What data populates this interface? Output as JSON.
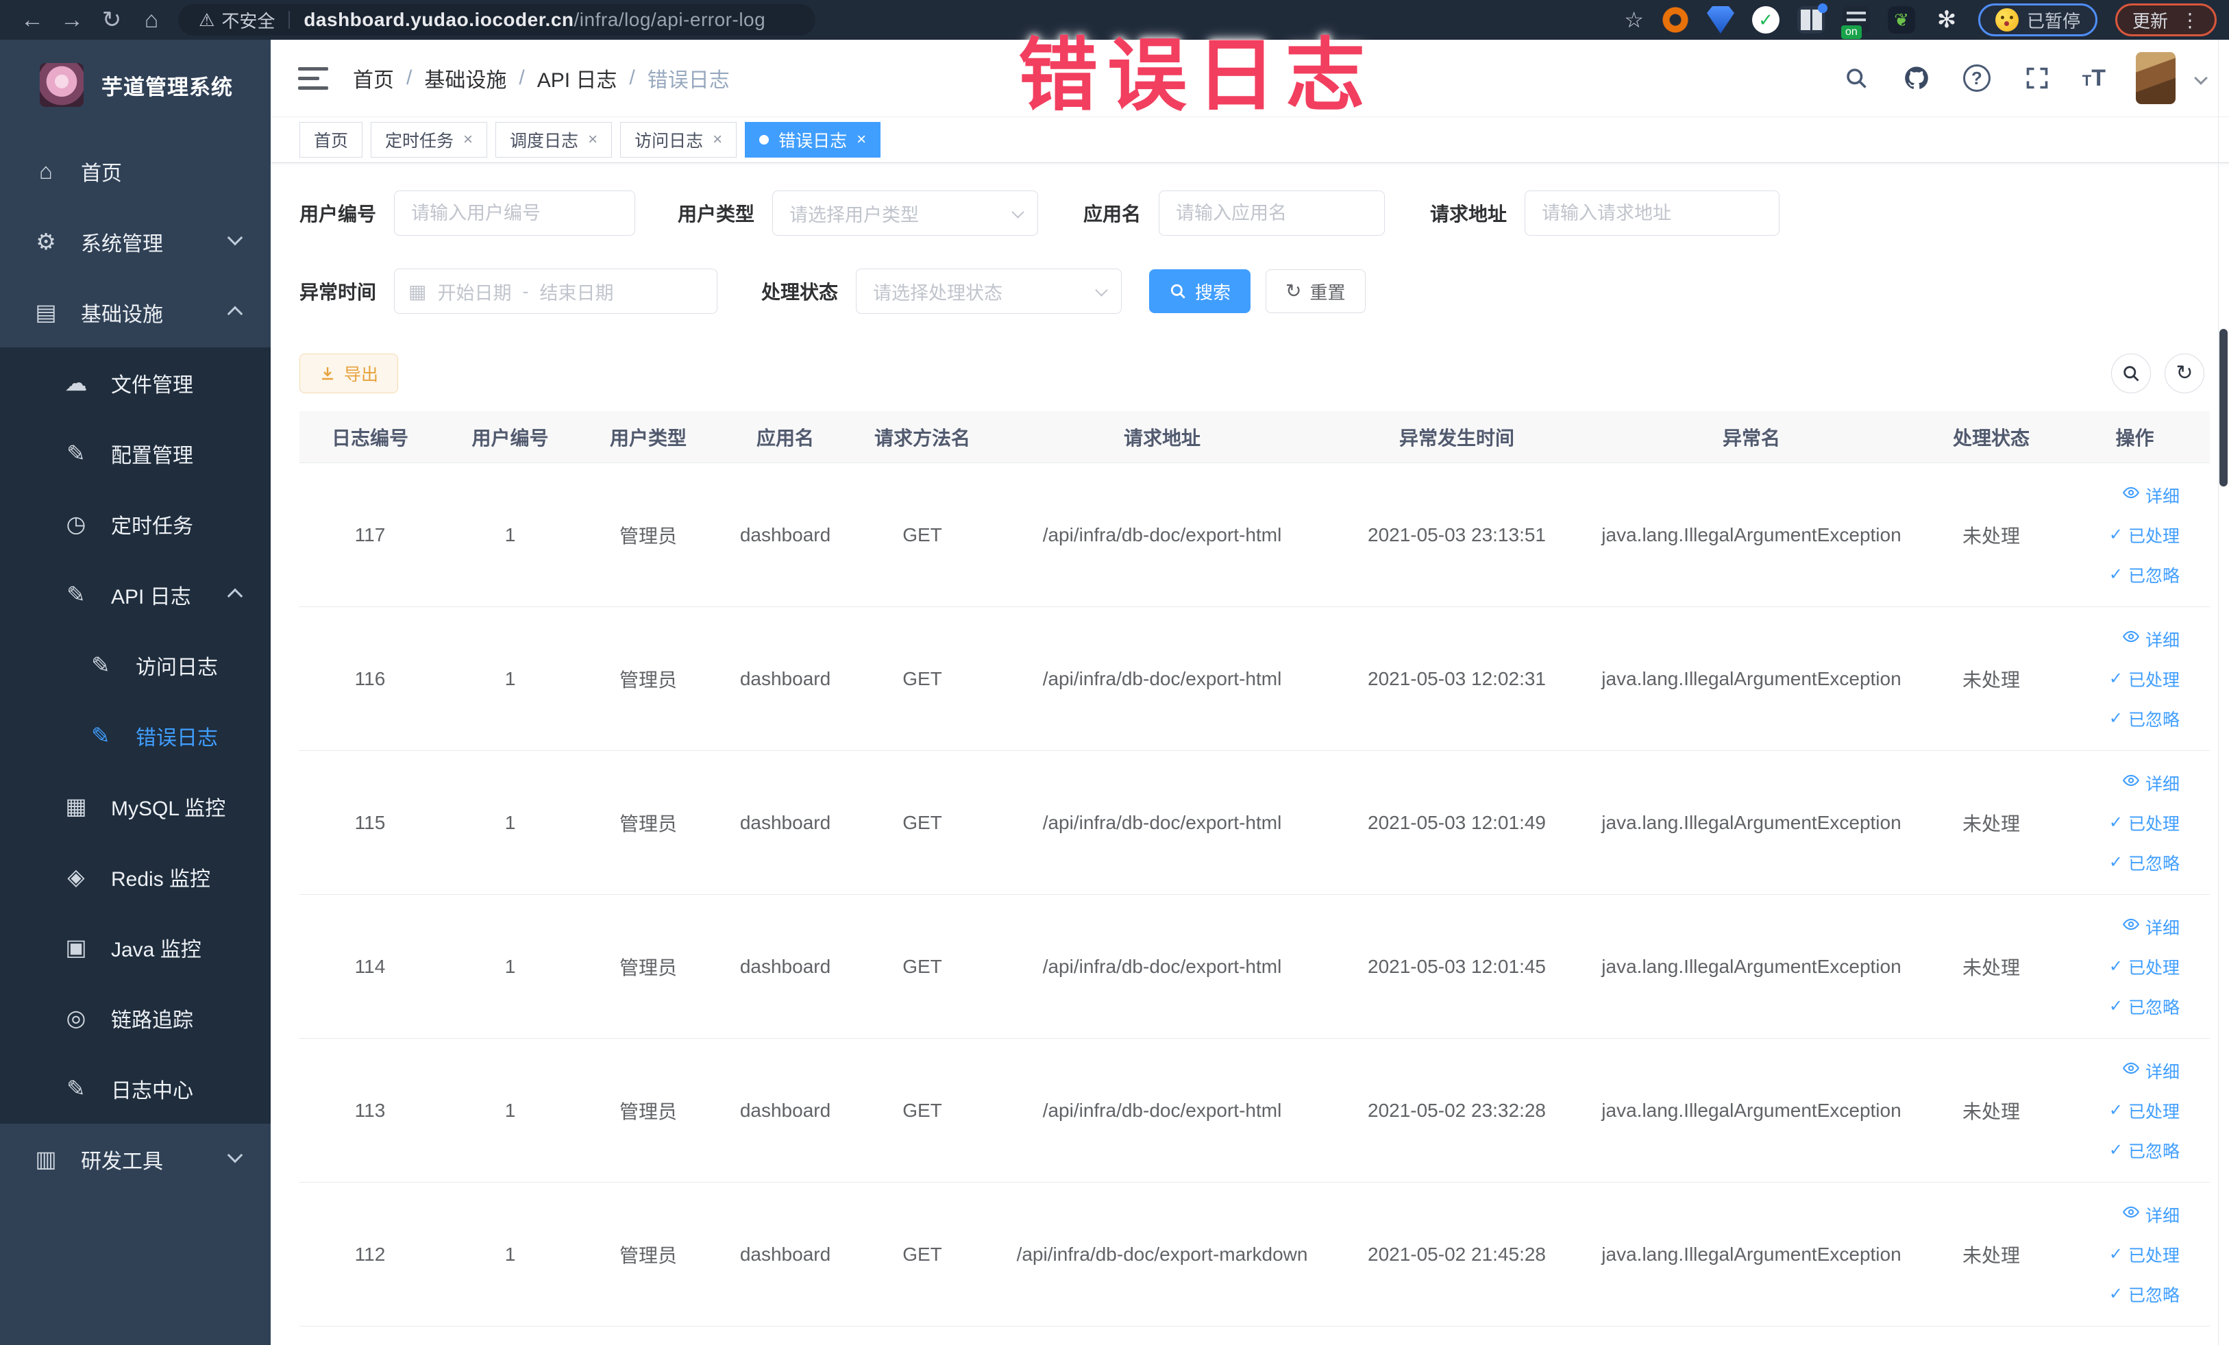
{
  "browser": {
    "security_label": "不安全",
    "url_host": "dashboard.yudao.iocoder.cn",
    "url_path": "/infra/log/api-error-log",
    "paused_label": "已暂停",
    "update_label": "更新"
  },
  "annotation": {
    "text": "错误日志",
    "color": "#f23f5f"
  },
  "sidebar": {
    "title": "芋道管理系统",
    "items": [
      {
        "label": "首页",
        "icon": "home-icon",
        "glyph": "⌂",
        "level": 0,
        "sub": false,
        "active": false,
        "chevron": ""
      },
      {
        "label": "系统管理",
        "icon": "gear-icon",
        "glyph": "⚙",
        "level": 0,
        "sub": false,
        "active": false,
        "chevron": "down"
      },
      {
        "label": "基础设施",
        "icon": "monitor-icon",
        "glyph": "▤",
        "level": 0,
        "sub": false,
        "active": false,
        "chevron": "up"
      },
      {
        "label": "文件管理",
        "icon": "cloud-icon",
        "glyph": "☁",
        "level": 1,
        "sub": true,
        "active": false,
        "chevron": ""
      },
      {
        "label": "配置管理",
        "icon": "edit-icon",
        "glyph": "✎",
        "level": 1,
        "sub": true,
        "active": false,
        "chevron": ""
      },
      {
        "label": "定时任务",
        "icon": "timer-icon",
        "glyph": "◷",
        "level": 1,
        "sub": true,
        "active": false,
        "chevron": ""
      },
      {
        "label": "API 日志",
        "icon": "api-log-icon",
        "glyph": "✎",
        "level": 1,
        "sub": true,
        "active": false,
        "chevron": "up"
      },
      {
        "label": "访问日志",
        "icon": "access-log-icon",
        "glyph": "✎",
        "level": 2,
        "sub": true,
        "active": false,
        "chevron": ""
      },
      {
        "label": "错误日志",
        "icon": "error-log-icon",
        "glyph": "✎",
        "level": 2,
        "sub": true,
        "active": true,
        "chevron": ""
      },
      {
        "label": "MySQL 监控",
        "icon": "mysql-icon",
        "glyph": "▦",
        "level": 1,
        "sub": true,
        "active": false,
        "chevron": ""
      },
      {
        "label": "Redis 监控",
        "icon": "redis-icon",
        "glyph": "◈",
        "level": 1,
        "sub": true,
        "active": false,
        "chevron": ""
      },
      {
        "label": "Java 监控",
        "icon": "java-icon",
        "glyph": "▣",
        "level": 1,
        "sub": true,
        "active": false,
        "chevron": ""
      },
      {
        "label": "链路追踪",
        "icon": "trace-icon",
        "glyph": "◎",
        "level": 1,
        "sub": true,
        "active": false,
        "chevron": ""
      },
      {
        "label": "日志中心",
        "icon": "log-center-icon",
        "glyph": "✎",
        "level": 1,
        "sub": true,
        "active": false,
        "chevron": ""
      },
      {
        "label": "研发工具",
        "icon": "toolbox-icon",
        "glyph": "▥",
        "level": 0,
        "sub": false,
        "active": false,
        "chevron": "down"
      }
    ]
  },
  "header": {
    "breadcrumb": [
      "首页",
      "基础设施",
      "API 日志",
      "错误日志"
    ]
  },
  "tags": [
    {
      "label": "首页",
      "closable": false,
      "active": false
    },
    {
      "label": "定时任务",
      "closable": true,
      "active": false
    },
    {
      "label": "调度日志",
      "closable": true,
      "active": false
    },
    {
      "label": "访问日志",
      "closable": true,
      "active": false
    },
    {
      "label": "错误日志",
      "closable": true,
      "active": true
    }
  ],
  "filters": {
    "user_id": {
      "label": "用户编号",
      "placeholder": "请输入用户编号"
    },
    "user_type": {
      "label": "用户类型",
      "placeholder": "请选择用户类型"
    },
    "app_name": {
      "label": "应用名",
      "placeholder": "请输入应用名"
    },
    "request_url": {
      "label": "请求地址",
      "placeholder": "请输入请求地址"
    },
    "exception_time": {
      "label": "异常时间",
      "start_placeholder": "开始日期",
      "separator": "-",
      "end_placeholder": "结束日期"
    },
    "process_status": {
      "label": "处理状态",
      "placeholder": "请选择处理状态"
    },
    "search_label": "搜索",
    "reset_label": "重置"
  },
  "toolbar": {
    "export_label": "导出"
  },
  "table": {
    "columns": [
      "日志编号",
      "用户编号",
      "用户类型",
      "应用名",
      "请求方法名",
      "请求地址",
      "异常发生时间",
      "异常名",
      "处理状态",
      "操作"
    ],
    "row_actions": [
      {
        "label": "详细",
        "icon": "eye-icon"
      },
      {
        "label": "已处理",
        "icon": "check-icon"
      },
      {
        "label": "已忽略",
        "icon": "check-icon"
      }
    ],
    "rows": [
      [
        "117",
        "1",
        "管理员",
        "dashboard",
        "GET",
        "/api/infra/db-doc/export-html",
        "2021-05-03 23:13:51",
        "java.lang.IllegalArgumentException",
        "未处理"
      ],
      [
        "116",
        "1",
        "管理员",
        "dashboard",
        "GET",
        "/api/infra/db-doc/export-html",
        "2021-05-03 12:02:31",
        "java.lang.IllegalArgumentException",
        "未处理"
      ],
      [
        "115",
        "1",
        "管理员",
        "dashboard",
        "GET",
        "/api/infra/db-doc/export-html",
        "2021-05-03 12:01:49",
        "java.lang.IllegalArgumentException",
        "未处理"
      ],
      [
        "114",
        "1",
        "管理员",
        "dashboard",
        "GET",
        "/api/infra/db-doc/export-html",
        "2021-05-03 12:01:45",
        "java.lang.IllegalArgumentException",
        "未处理"
      ],
      [
        "113",
        "1",
        "管理员",
        "dashboard",
        "GET",
        "/api/infra/db-doc/export-html",
        "2021-05-02 23:32:28",
        "java.lang.IllegalArgumentException",
        "未处理"
      ],
      [
        "112",
        "1",
        "管理员",
        "dashboard",
        "GET",
        "/api/infra/db-doc/export-markdown",
        "2021-05-02 21:45:28",
        "java.lang.IllegalArgumentException",
        "未处理"
      ]
    ]
  },
  "colors": {
    "accent": "#409EFF",
    "warning": "#e6a23c",
    "sidebar_bg": "#304156",
    "submenu_bg": "#1f2d3d"
  }
}
